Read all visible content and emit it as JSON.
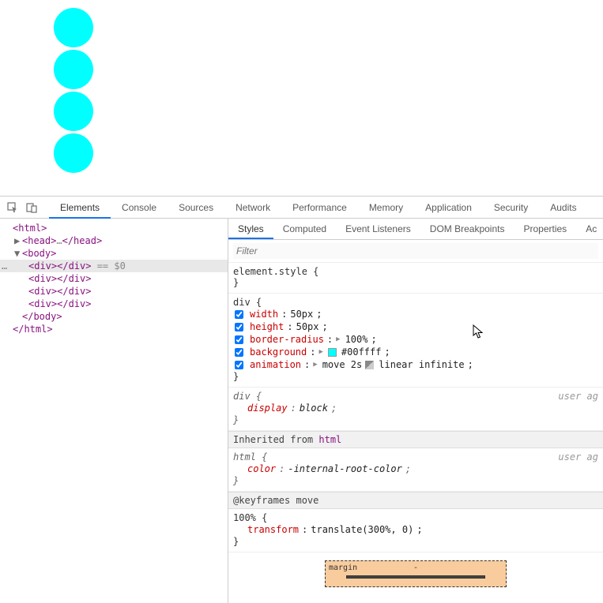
{
  "page": {
    "circle_count": 4
  },
  "main_tabs": [
    "Elements",
    "Console",
    "Sources",
    "Network",
    "Performance",
    "Memory",
    "Application",
    "Security",
    "Audits"
  ],
  "main_tab_active": "Elements",
  "dom": {
    "lines": [
      {
        "indent": 0,
        "arrow": "",
        "html": "<html>"
      },
      {
        "indent": 1,
        "arrow": "▶",
        "html": "<head>…</head>"
      },
      {
        "indent": 1,
        "arrow": "▼",
        "html": "<body>"
      },
      {
        "indent": 2,
        "arrow": "",
        "html": "<div></div>",
        "selected": true,
        "suffix": " == $0"
      },
      {
        "indent": 2,
        "arrow": "",
        "html": "<div></div>"
      },
      {
        "indent": 2,
        "arrow": "",
        "html": "<div></div>"
      },
      {
        "indent": 2,
        "arrow": "",
        "html": "<div></div>"
      },
      {
        "indent": 1,
        "arrow": "",
        "html": "</body>"
      },
      {
        "indent": 0,
        "arrow": "",
        "html": "</html>"
      }
    ]
  },
  "styles_tabs": [
    "Styles",
    "Computed",
    "Event Listeners",
    "DOM Breakpoints",
    "Properties",
    "Ac"
  ],
  "styles_tab_active": "Styles",
  "filter_placeholder": "Filter",
  "rules": {
    "element_style": {
      "selector": "element.style",
      "decls": []
    },
    "div_rule": {
      "selector": "div",
      "decls": [
        {
          "prop": "width",
          "val": "50px"
        },
        {
          "prop": "height",
          "val": "50px"
        },
        {
          "prop": "border-radius",
          "val": "100%",
          "expand": true
        },
        {
          "prop": "background",
          "val": "#00ffff",
          "swatch": true,
          "expand": true
        },
        {
          "prop": "animation",
          "val": "move 2s",
          "timing": true,
          "val2": "linear infinite",
          "expand": true
        }
      ]
    },
    "div_ua": {
      "selector": "div",
      "useragent": "user ag",
      "decls_it": [
        {
          "prop": "display",
          "val": "block"
        }
      ]
    },
    "inherited_label": "Inherited from ",
    "inherited_from": "html",
    "html_ua": {
      "selector": "html",
      "useragent": "user ag",
      "decls_it": [
        {
          "prop": "color",
          "val": "-internal-root-color"
        }
      ]
    },
    "keyframes_label": "@keyframes move",
    "keyframe": {
      "selector": "100%",
      "decls": [
        {
          "prop": "transform",
          "val": "translate(300%, 0)"
        }
      ]
    }
  },
  "boxmodel": {
    "label": "margin",
    "top": "-"
  }
}
